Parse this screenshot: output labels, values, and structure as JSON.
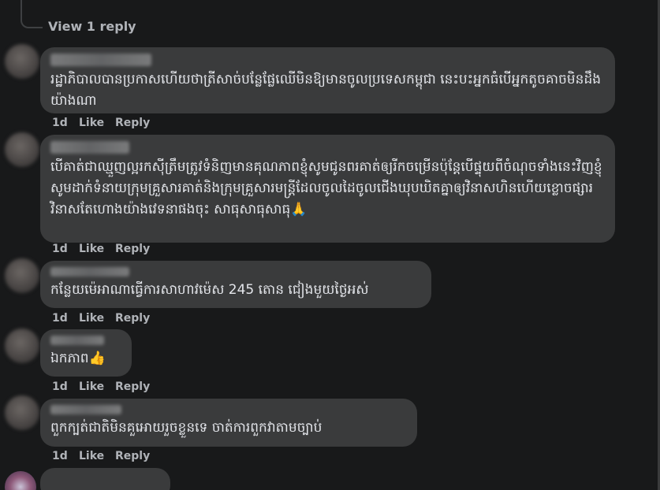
{
  "top_actions": "1d  Like  Reply",
  "view_reply": "View 1 reply",
  "comments": [
    {
      "text": "រដ្ឋាភិបាលបានប្រកាសហើយថាត្រីសាច់បន្លែផ្លែឈើមិនឱ្យមានចូលប្រទេសកម្ពុជា នេះបះអ្នកធំបើអ្នកតូចគាចមិនដឹងយ៉ាងណា",
      "time": "1d",
      "like": "Like",
      "reply": "Reply"
    },
    {
      "text": "បើគាត់ជាឈ្មួញល្អរកស៊ីត្រឹមត្រូវទំនិញមានគុណភាពខ្ញុំសូមជូនពរគាត់ឲ្យរីកចម្រើនប៉ុន្តែបើផ្ទុយពីចំណុចទាំងនេះវិញខ្ញុំសូមដាក់ទំនាយក្រុមគ្រួសារគាត់និងក្រុមគ្រួសារមន្ត្រីដែលចូលដៃចូលជើងឃុបឃិតគ្នាឲ្យវិនាសហិនហើយខ្លោចផ្សារ វិនាសតែហោងយ៉ាងវេទនាផងចុះ សាធុសាធុសាធុ🙏",
      "time": "1d",
      "like": "Like",
      "reply": "Reply"
    },
    {
      "text": "កន្លែយម៉េអាណាធ្វើការសាហាវម៉េស 245 តោន ជៀងមួយថ្ងៃអស់",
      "time": "1d",
      "like": "Like",
      "reply": "Reply"
    },
    {
      "text": "ឯកភាព👍",
      "time": "1d",
      "like": "Like",
      "reply": "Reply"
    },
    {
      "text": "ពួកក្បត់ជាតិមិនគួអោយរួចខ្លួនទេ ចាត់ការពួកវាតាមច្បាប់",
      "time": "1d",
      "like": "Like",
      "reply": "Reply"
    }
  ]
}
